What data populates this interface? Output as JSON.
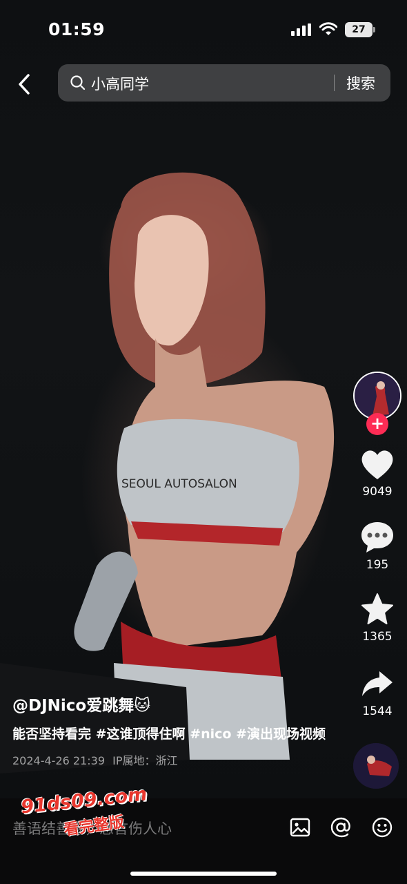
{
  "status_bar": {
    "time": "01:59",
    "battery": "27"
  },
  "search": {
    "query": "小高同学",
    "button_label": "搜索"
  },
  "rail": {
    "likes": "9049",
    "comments": "195",
    "favorites": "1365",
    "shares": "1544",
    "follow_symbol": "+"
  },
  "caption": {
    "author": "@DJNico爱跳舞",
    "author_emoji": "🐱",
    "description": "能否坚持看完 #这谁顶得住啊 #nico #演出现场视频",
    "date": "2024-4-26 21:39",
    "ip_location": "IP属地：浙江"
  },
  "video": {
    "shirt_text": "SEOUL AUTOSALON"
  },
  "bottom": {
    "comment_placeholder": "善语结善缘，恶言伤人心"
  },
  "watermark": {
    "site": "91ds09.com",
    "tagline": "看完整版"
  },
  "colors": {
    "accent": "#fe2c55",
    "watermark": "#e8372e"
  }
}
